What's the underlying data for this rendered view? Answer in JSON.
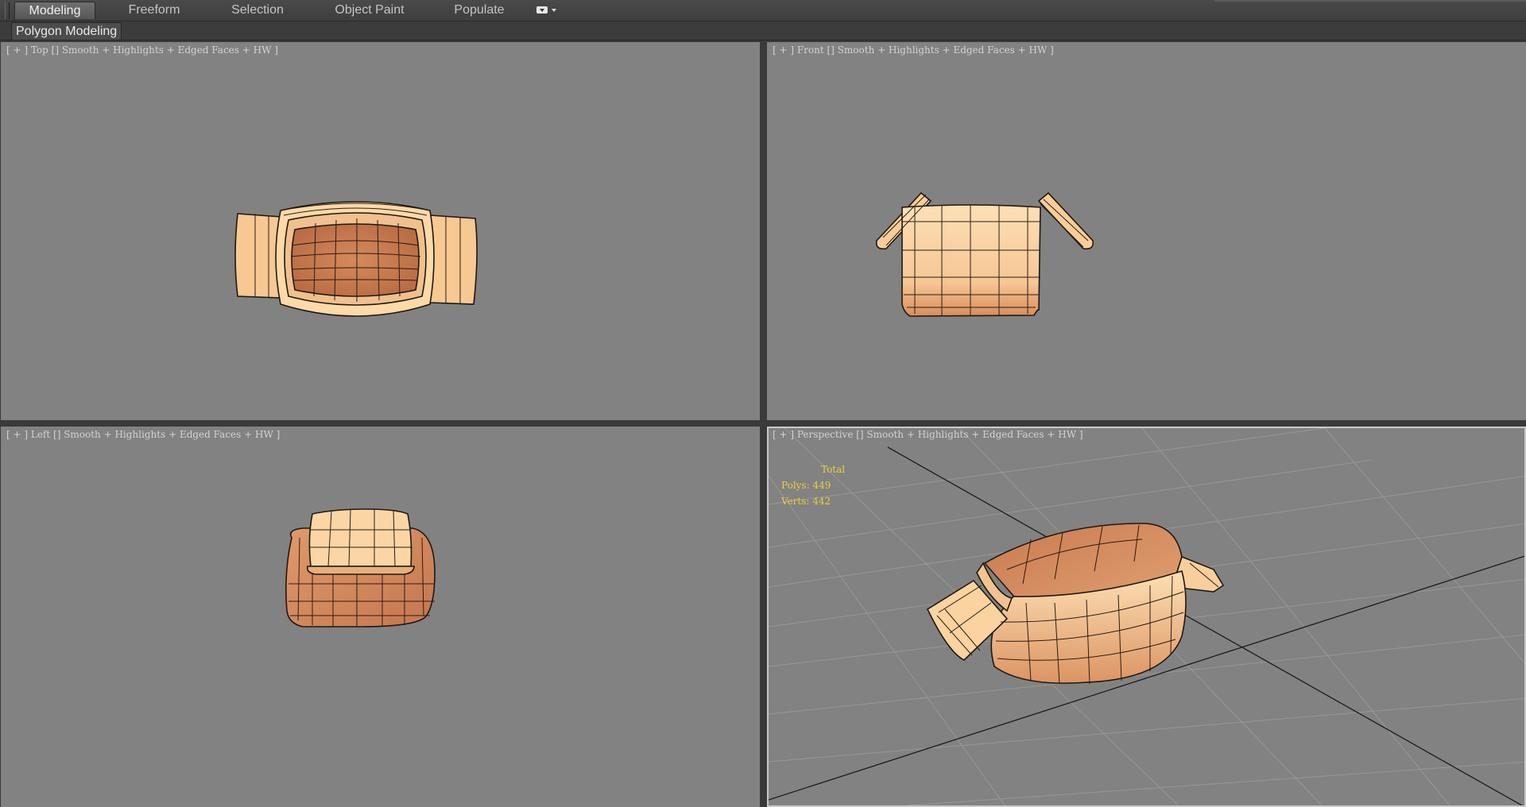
{
  "ribbon": {
    "tabs": [
      {
        "label": "Modeling",
        "active": true
      },
      {
        "label": "Freeform",
        "active": false
      },
      {
        "label": "Selection",
        "active": false
      },
      {
        "label": "Object Paint",
        "active": false
      },
      {
        "label": "Populate",
        "active": false
      }
    ],
    "panel_label": "Polygon Modeling"
  },
  "viewports": {
    "top": {
      "label": "[ + ] Top [] Smooth + Highlights + Edged Faces + HW ]"
    },
    "front": {
      "label": "[ + ] Front [] Smooth + Highlights + Edged Faces + HW ]"
    },
    "left": {
      "label": "[ + ] Left [] Smooth + Highlights + Edged Faces + HW ]"
    },
    "perspective": {
      "label": "[ + ] Perspective [] Smooth + Highlights + Edged Faces + HW ]"
    }
  },
  "stats": {
    "title": "Total",
    "polys": "Polys: 449",
    "verts": "Verts: 442"
  },
  "colors": {
    "viewport_bg": "#828282",
    "mesh_light": "#fdd7a8",
    "mesh_dark": "#c97a4f",
    "stats_text": "#e9d03a",
    "active_viewport_border": "#c9c9c9"
  }
}
